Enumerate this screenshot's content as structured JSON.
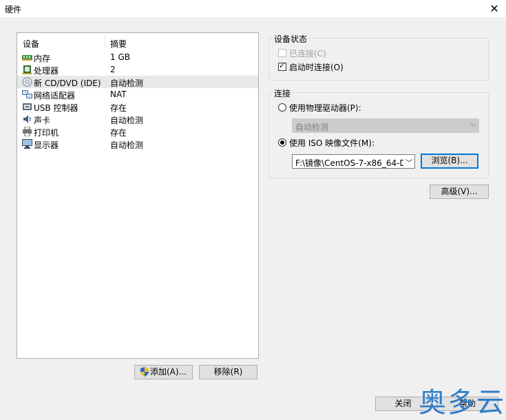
{
  "window": {
    "title": "硬件",
    "close_glyph": "✕"
  },
  "device_list": {
    "columns": [
      "设备",
      "摘要"
    ],
    "rows": [
      {
        "name": "内存",
        "summary": "1 GB",
        "icon": "memory-icon"
      },
      {
        "name": "处理器",
        "summary": "2",
        "icon": "processor-icon"
      },
      {
        "name": "新 CD/DVD (IDE)",
        "summary": "自动检测",
        "icon": "cd-dvd-icon",
        "selected": true
      },
      {
        "name": "网络适配器",
        "summary": "NAT",
        "icon": "network-adapter-icon"
      },
      {
        "name": "USB 控制器",
        "summary": "存在",
        "icon": "usb-icon"
      },
      {
        "name": "声卡",
        "summary": "自动检测",
        "icon": "sound-card-icon"
      },
      {
        "name": "打印机",
        "summary": "存在",
        "icon": "printer-icon"
      },
      {
        "name": "显示器",
        "summary": "自动检测",
        "icon": "display-icon"
      }
    ]
  },
  "buttons": {
    "add": "添加(A)...",
    "remove": "移除(R)",
    "browse": "浏览(B)...",
    "advanced": "高级(V)...",
    "close": "关闭",
    "help": "帮助"
  },
  "device_status": {
    "title": "设备状态",
    "connected_label": "已连接(C)",
    "connected_checked": false,
    "connected_disabled": true,
    "connect_at_power_on_label": "启动时连接(O)",
    "connect_at_power_on_checked": true
  },
  "connection": {
    "title": "连接",
    "physical_drive_label": "使用物理驱动器(P):",
    "physical_drive_selected": false,
    "physical_drive_value": "自动检测",
    "iso_label": "使用 ISO 映像文件(M):",
    "iso_selected": true,
    "iso_path": "F:\\镜像\\CentOS-7-x86_64-D"
  },
  "watermark": "奥多云",
  "colors": {
    "focus_border": "#0078d7",
    "watermark": "#2f7dc9"
  }
}
